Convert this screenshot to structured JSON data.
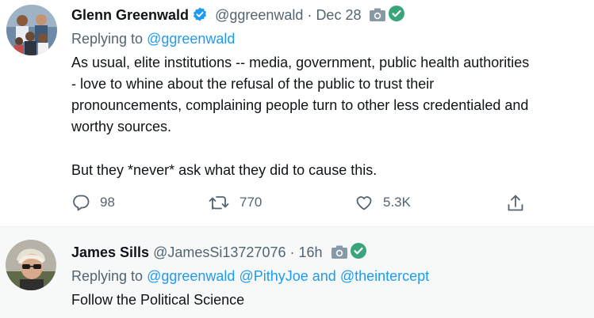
{
  "tweet1": {
    "author_name": "Glenn Greenwald",
    "handle": "@ggreenwald",
    "date": "Dec 28",
    "verified": true,
    "replying_label": "Replying to",
    "replying_to": "@ggreenwald",
    "text_lines": [
      "As usual, elite institutions -- media, government, public health authorities",
      "- love to whine about the refusal of the public to trust their",
      "pronouncements, complaining people turn to other less credentialed and",
      "worthy sources."
    ],
    "text_line_2": "But they *never* ask what they did to cause this.",
    "actions": {
      "reply_count": "98",
      "retweet_count": "770",
      "like_count": "5.3K"
    }
  },
  "tweet2": {
    "author_name": "James Sills",
    "handle": "@JamesSi13727076",
    "time": "16h",
    "replying_label": "Replying to",
    "replying_to_1": "@ggreenwald",
    "replying_to_2": "@PithyJoe",
    "replying_and": "and",
    "replying_to_3": "@theintercept",
    "text": "Follow the Political Science"
  },
  "separator": "·",
  "colors": {
    "link": "#1d9bf0",
    "muted": "#536471",
    "verified": "#1d9bf0",
    "extension_check": "#3aa57a",
    "reply_background": "#f7f9f9"
  },
  "icons": [
    "verified-badge-icon",
    "camera-icon",
    "green-check-icon",
    "reply-icon",
    "retweet-icon",
    "like-icon",
    "share-icon"
  ]
}
